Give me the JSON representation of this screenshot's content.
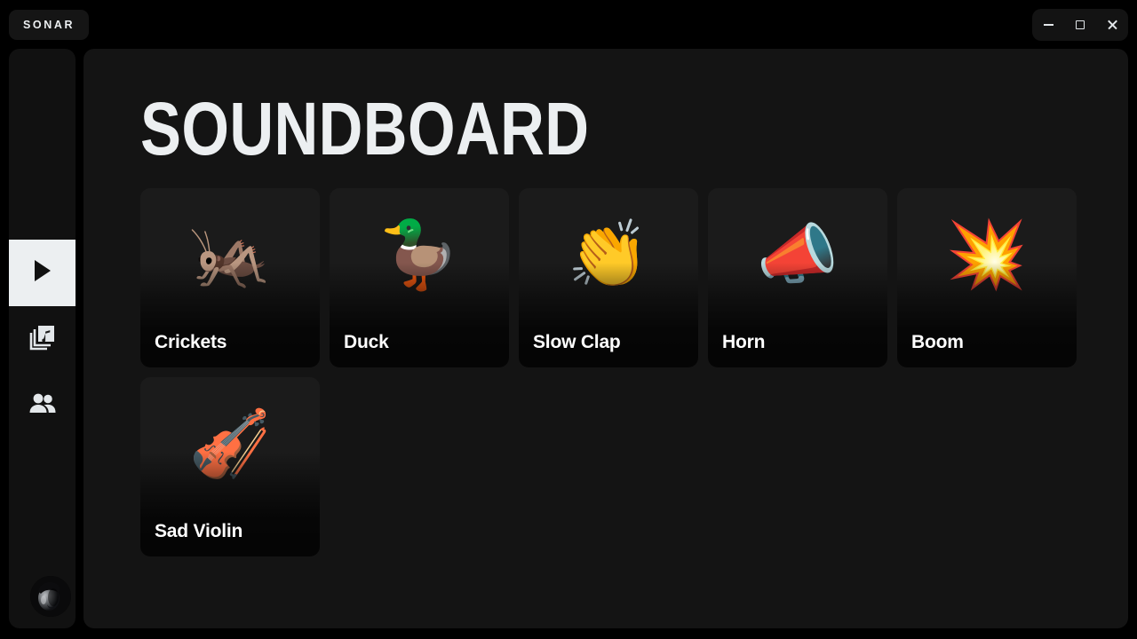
{
  "app": {
    "brand": "SONAR",
    "accent_light": "#eceff1",
    "background": "#000000",
    "panel_background": "#141414",
    "card_background": "#1b1b1b"
  },
  "window_controls": {
    "minimize": {
      "name": "minimize-button",
      "label": "Minimize"
    },
    "maximize": {
      "name": "maximize-button",
      "label": "Maximize"
    },
    "close": {
      "name": "close-button",
      "label": "Close"
    }
  },
  "sidebar": {
    "items": [
      {
        "icon": "play-icon",
        "label": "Play",
        "active": true
      },
      {
        "icon": "music-library-icon",
        "label": "Library",
        "active": false
      },
      {
        "icon": "people-icon",
        "label": "Friends",
        "active": false
      }
    ],
    "avatar": {
      "icon": "avatar",
      "label": "User avatar"
    }
  },
  "main": {
    "title": "SOUNDBOARD",
    "sounds": [
      {
        "name": "Crickets",
        "emoji": "🦗"
      },
      {
        "name": "Duck",
        "emoji": "🦆"
      },
      {
        "name": "Slow Clap",
        "emoji": "👏"
      },
      {
        "name": "Horn",
        "emoji": "📣"
      },
      {
        "name": "Boom",
        "emoji": "💥"
      },
      {
        "name": "Sad Violin",
        "emoji": "🎻"
      }
    ]
  }
}
